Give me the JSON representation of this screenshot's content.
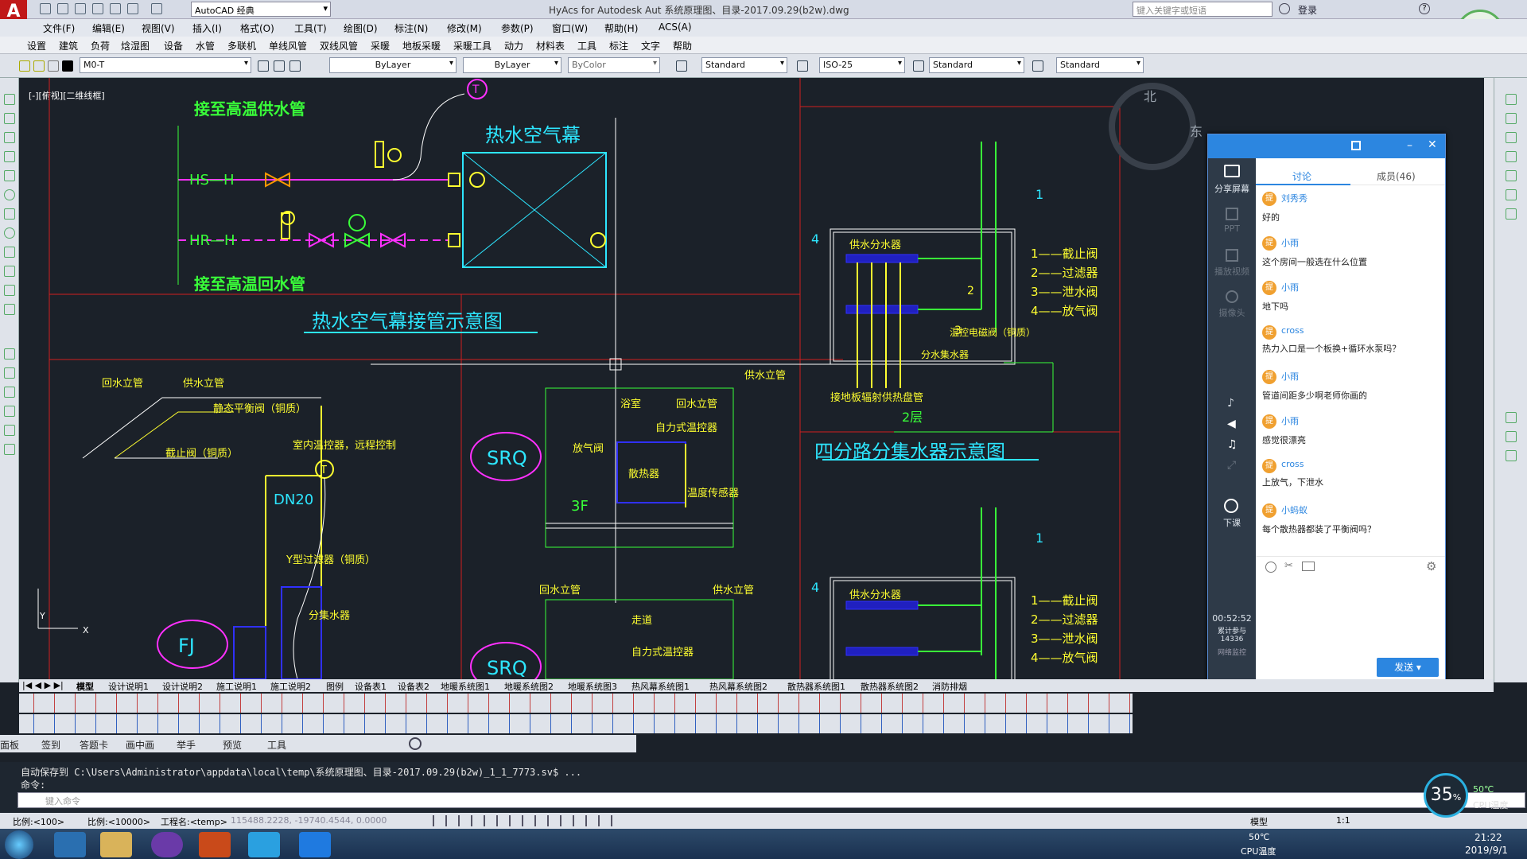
{
  "title": {
    "app_menu_name": "AutoCAD 经典",
    "text": "HyAcs for Autodesk Aut      系统原理图、目录-2017.09.29(b2w).dwg",
    "search_placeholder": "键入关键字或短语",
    "login": "登录"
  },
  "menu": [
    "文件(F)",
    "编辑(E)",
    "视图(V)",
    "插入(I)",
    "格式(O)",
    "工具(T)",
    "绘图(D)",
    "标注(N)",
    "修改(M)",
    "参数(P)",
    "窗口(W)",
    "帮助(H)",
    "ACS(A)"
  ],
  "hymenu": [
    "设置",
    "建筑",
    "负荷",
    "焓湿图",
    "设备",
    "水管",
    "多联机",
    "单线风管",
    "双线风管",
    "采暖",
    "地板采暖",
    "采暖工具",
    "动力",
    "材料表",
    "工具",
    "标注",
    "文字",
    "帮助"
  ],
  "props": {
    "layer": "M0-T",
    "linetype": "ByLayer",
    "lineweight": "ByLayer",
    "color": "ByColor",
    "textstyle": "Standard",
    "dimstyle": "ISO-25",
    "tablestyle": "Standard",
    "mleaderstyle": "Standard"
  },
  "viewport_label": "[-][俯视][二维线框]",
  "viewcube": {
    "north": "北",
    "east": "东"
  },
  "drawing": {
    "hs_label": "接至高温供水管",
    "hr_label": "接至高温回水管",
    "hs": "HS—H",
    "hr": "HR—H",
    "ac_title": "热水空气幕",
    "ac_caption": "热水空气幕接管示意图",
    "return_riser": "回水立管",
    "supply_riser": "供水立管",
    "balance_valve": "静态平衡阀（铜质）",
    "stop_valve": "截止阀（铜质）",
    "thermostat": "室内温控器，远程控制",
    "dn": "DN20",
    "y_filter": "Y型过滤器（铜质）",
    "manifold": "分集水器",
    "srq": "SRQ",
    "fj": "FJ",
    "vent": "放气阀",
    "hx": "散热器",
    "self_valve": "自力式温控器",
    "temp_sensor": "温度传感器",
    "floor3": "3F",
    "bath": "浴室",
    "corridor": "走道",
    "supply_mf": "供水分水器",
    "return_mf": "分水集水器",
    "legend": [
      "1——截止阀",
      "2——过滤器",
      "3——泄水阀",
      "4——放气阀"
    ],
    "remote_valve": "温控电磁阀（铜质）",
    "floor_heat": "接地板辐射供热盘管",
    "floor2": "2层",
    "mf_caption": "四分路分集水器示意图",
    "riser_supply2": "供水立管",
    "num1": "1",
    "num2": "2",
    "num3": "3",
    "num4": "4"
  },
  "tabs": [
    "模型",
    "设计说明1",
    "设计说明2",
    "施工说明1",
    "施工说明2",
    "图例",
    "设备表1",
    "设备表2",
    "地暖系统图1",
    "地暖系统图2",
    "地暖系统图3",
    "热风幕系统图1",
    "热风幕系统图2",
    "散热器系统图1",
    "散热器系统图2",
    "消防排烟"
  ],
  "bottombar": [
    "面板",
    "签到",
    "答题卡",
    "画中画",
    "举手",
    "预览",
    "工具"
  ],
  "command": {
    "line1": "自动保存到 C:\\Users\\Administrator\\appdata\\local\\temp\\系统原理图、目录-2017.09.29(b2w)_1_1_7773.sv$ ...",
    "line2": "命令:",
    "placeholder": "键入命令"
  },
  "status": {
    "scale": "比例:<100>",
    "scale2": "比例:<10000>",
    "proj": "工程名:<temp>",
    "coords": "115488.2228, -19740.4544, 0.0000",
    "model": "模型",
    "annot": "1:1"
  },
  "chat": {
    "tab_discuss": "讨论",
    "tab_members": "成员(46)",
    "share": "分享屏幕",
    "ppt": "PPT",
    "video": "播放视频",
    "camera": "摄像头",
    "down": "下课",
    "timer": "00:52:52",
    "online": "累计参与 14336",
    "network": "网络监控",
    "send": "发送",
    "messages": [
      {
        "name": "刘秀秀",
        "text": "好的"
      },
      {
        "name": "小雨",
        "text": "这个房间一般选在什么位置"
      },
      {
        "name": "小雨",
        "text": "地下吗"
      },
      {
        "name": "cross",
        "text": "热力入口是一个板换+循环水泵吗？"
      },
      {
        "name": "小雨",
        "text": "管道间距多少啊老师你画的"
      },
      {
        "name": "小雨",
        "text": "感觉很漂亮"
      },
      {
        "name": "cross",
        "text": "上放气，下泄水"
      },
      {
        "name": "小蚂蚁",
        "text": "每个散热器都装了平衡阀吗？"
      }
    ]
  },
  "cpu": {
    "percent": "35",
    "unit": "%",
    "temp": "50℃",
    "label": "CPU温度"
  },
  "tray": {
    "time": "21:22",
    "date": "2019/9/1",
    "temp": "50℃",
    "templabel": "CPU温度"
  },
  "colors": {
    "canvas": "#1b2129",
    "green": "#39ff39",
    "cyan": "#2de6ff",
    "yellow": "#ffff30",
    "magenta": "#ff30ff",
    "red": "#d02020",
    "blue": "#3030ff"
  }
}
